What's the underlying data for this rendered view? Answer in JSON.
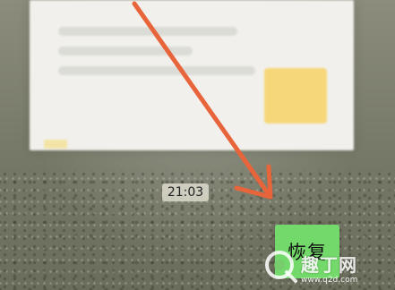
{
  "time_badge": {
    "text": "21:03"
  },
  "restore_button": {
    "label": "恢复"
  },
  "watermark": {
    "text": "趣丁网",
    "url": "www.q2d.com"
  },
  "colors": {
    "arrow": "#e8643a",
    "button": "#73d96a"
  }
}
